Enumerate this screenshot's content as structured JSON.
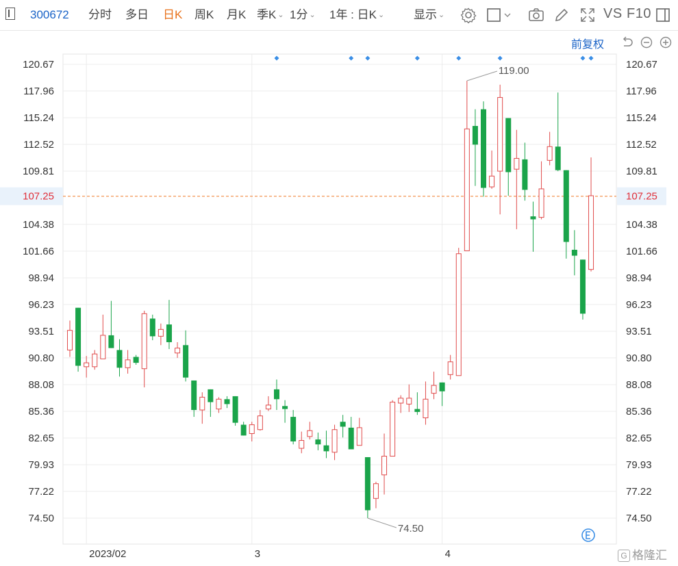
{
  "toolbar": {
    "code": "300672",
    "tabs": [
      "分时",
      "多日",
      "日K",
      "周K",
      "月K",
      "季K",
      "1分"
    ],
    "active_tab": "日K",
    "range_select": "1年 : 日K",
    "display_label": "显示",
    "vs_label": "VS",
    "f10_label": "F10"
  },
  "chart_controls": {
    "fuquan_label": "前复权"
  },
  "watermark": "格隆汇",
  "chart_data": {
    "type": "candlestick",
    "y_ticks": [
      "120.67",
      "117.96",
      "115.24",
      "112.52",
      "109.81",
      "107.25",
      "104.38",
      "101.66",
      "98.94",
      "96.23",
      "93.51",
      "90.80",
      "88.08",
      "85.36",
      "82.65",
      "79.93",
      "77.22",
      "74.50"
    ],
    "y_range": [
      74.5,
      120.67
    ],
    "current_price": "107.25",
    "x_labels": [
      {
        "label": "2023/02",
        "index": 2
      },
      {
        "label": "3",
        "index": 22
      },
      {
        "label": "4",
        "index": 45
      }
    ],
    "high_label": "119.00",
    "low_label": "74.50",
    "event_marker_indices": [
      25,
      34,
      36,
      42,
      47,
      52,
      62,
      63
    ],
    "colors": {
      "up": "#e04a4a",
      "down": "#1aa44a",
      "grid": "#ececec",
      "price_line": "#f07a2a",
      "marker": "#3a8ee6"
    },
    "candles": [
      {
        "o": 91.6,
        "h": 94.6,
        "l": 90.9,
        "c": 93.6
      },
      {
        "o": 95.9,
        "h": 95.9,
        "l": 89.4,
        "c": 90.0
      },
      {
        "o": 89.9,
        "h": 91.0,
        "l": 88.8,
        "c": 90.3
      },
      {
        "o": 89.9,
        "h": 91.6,
        "l": 89.6,
        "c": 91.2
      },
      {
        "o": 90.7,
        "h": 95.2,
        "l": 90.7,
        "c": 93.1
      },
      {
        "o": 93.1,
        "h": 96.6,
        "l": 91.8,
        "c": 91.8
      },
      {
        "o": 91.6,
        "h": 92.7,
        "l": 88.9,
        "c": 89.8
      },
      {
        "o": 89.8,
        "h": 91.6,
        "l": 89.2,
        "c": 90.6
      },
      {
        "o": 90.9,
        "h": 91.1,
        "l": 90.1,
        "c": 90.3
      },
      {
        "o": 89.7,
        "h": 95.6,
        "l": 87.8,
        "c": 95.3
      },
      {
        "o": 94.8,
        "h": 95.2,
        "l": 92.6,
        "c": 93.0
      },
      {
        "o": 93.0,
        "h": 94.3,
        "l": 92.1,
        "c": 93.7
      },
      {
        "o": 94.2,
        "h": 96.7,
        "l": 91.7,
        "c": 92.4
      },
      {
        "o": 91.3,
        "h": 92.4,
        "l": 90.8,
        "c": 91.8
      },
      {
        "o": 92.1,
        "h": 93.6,
        "l": 88.4,
        "c": 88.8
      },
      {
        "o": 88.5,
        "h": 88.5,
        "l": 84.8,
        "c": 85.5
      },
      {
        "o": 85.5,
        "h": 87.3,
        "l": 84.1,
        "c": 86.8
      },
      {
        "o": 87.6,
        "h": 87.6,
        "l": 84.8,
        "c": 86.3
      },
      {
        "o": 85.6,
        "h": 86.8,
        "l": 85.2,
        "c": 86.6
      },
      {
        "o": 86.6,
        "h": 86.9,
        "l": 85.7,
        "c": 86.1
      },
      {
        "o": 86.9,
        "h": 86.9,
        "l": 83.9,
        "c": 84.2
      },
      {
        "o": 84.0,
        "h": 84.3,
        "l": 82.9,
        "c": 82.9
      },
      {
        "o": 83.1,
        "h": 84.3,
        "l": 82.3,
        "c": 84.0
      },
      {
        "o": 83.5,
        "h": 85.5,
        "l": 83.4,
        "c": 84.9
      },
      {
        "o": 85.6,
        "h": 86.9,
        "l": 85.4,
        "c": 86.0
      },
      {
        "o": 87.6,
        "h": 88.6,
        "l": 85.5,
        "c": 86.6
      },
      {
        "o": 85.9,
        "h": 86.5,
        "l": 84.2,
        "c": 85.6
      },
      {
        "o": 84.8,
        "h": 85.5,
        "l": 82.0,
        "c": 82.3
      },
      {
        "o": 81.6,
        "h": 83.3,
        "l": 81.1,
        "c": 82.4
      },
      {
        "o": 82.8,
        "h": 84.3,
        "l": 82.5,
        "c": 83.4
      },
      {
        "o": 82.5,
        "h": 83.2,
        "l": 81.4,
        "c": 82.0
      },
      {
        "o": 81.9,
        "h": 83.4,
        "l": 80.6,
        "c": 81.3
      },
      {
        "o": 81.2,
        "h": 84.0,
        "l": 80.4,
        "c": 83.5
      },
      {
        "o": 84.3,
        "h": 85.0,
        "l": 82.7,
        "c": 83.8
      },
      {
        "o": 83.7,
        "h": 84.8,
        "l": 81.5,
        "c": 81.5
      },
      {
        "o": 81.9,
        "h": 84.7,
        "l": 81.9,
        "c": 83.7
      },
      {
        "o": 80.7,
        "h": 80.7,
        "l": 74.5,
        "c": 75.3
      },
      {
        "o": 76.5,
        "h": 78.2,
        "l": 75.5,
        "c": 78.0
      },
      {
        "o": 78.9,
        "h": 83.1,
        "l": 76.9,
        "c": 80.8
      },
      {
        "o": 80.8,
        "h": 86.5,
        "l": 80.8,
        "c": 86.3
      },
      {
        "o": 86.2,
        "h": 87.0,
        "l": 85.2,
        "c": 86.7
      },
      {
        "o": 86.1,
        "h": 88.1,
        "l": 85.3,
        "c": 86.7
      },
      {
        "o": 85.6,
        "h": 87.3,
        "l": 85.0,
        "c": 85.3
      },
      {
        "o": 84.7,
        "h": 88.4,
        "l": 84.0,
        "c": 86.6
      },
      {
        "o": 87.2,
        "h": 89.4,
        "l": 86.6,
        "c": 88.0
      },
      {
        "o": 88.3,
        "h": 88.3,
        "l": 85.9,
        "c": 87.4
      },
      {
        "o": 89.1,
        "h": 91.1,
        "l": 88.6,
        "c": 90.4
      },
      {
        "o": 89.0,
        "h": 102.0,
        "l": 89.0,
        "c": 101.4
      },
      {
        "o": 101.7,
        "h": 119.0,
        "l": 101.7,
        "c": 114.1
      },
      {
        "o": 114.4,
        "h": 116.1,
        "l": 108.3,
        "c": 112.5
      },
      {
        "o": 116.1,
        "h": 116.9,
        "l": 107.2,
        "c": 108.1
      },
      {
        "o": 108.2,
        "h": 111.9,
        "l": 108.0,
        "c": 109.3
      },
      {
        "o": 109.8,
        "h": 118.6,
        "l": 105.4,
        "c": 117.3
      },
      {
        "o": 115.2,
        "h": 115.2,
        "l": 107.3,
        "c": 109.7
      },
      {
        "o": 110.0,
        "h": 114.0,
        "l": 103.9,
        "c": 111.1
      },
      {
        "o": 111.0,
        "h": 112.7,
        "l": 106.8,
        "c": 107.9
      },
      {
        "o": 105.2,
        "h": 106.7,
        "l": 101.6,
        "c": 104.9
      },
      {
        "o": 105.1,
        "h": 110.8,
        "l": 104.9,
        "c": 108.0
      },
      {
        "o": 110.9,
        "h": 113.8,
        "l": 110.4,
        "c": 112.3
      },
      {
        "o": 112.3,
        "h": 117.8,
        "l": 109.8,
        "c": 109.9
      },
      {
        "o": 109.9,
        "h": 109.9,
        "l": 100.9,
        "c": 102.6
      },
      {
        "o": 101.8,
        "h": 103.8,
        "l": 99.2,
        "c": 101.2
      },
      {
        "o": 100.8,
        "h": 100.8,
        "l": 94.7,
        "c": 95.3
      },
      {
        "o": 99.8,
        "h": 111.2,
        "l": 99.6,
        "c": 107.3
      }
    ]
  }
}
